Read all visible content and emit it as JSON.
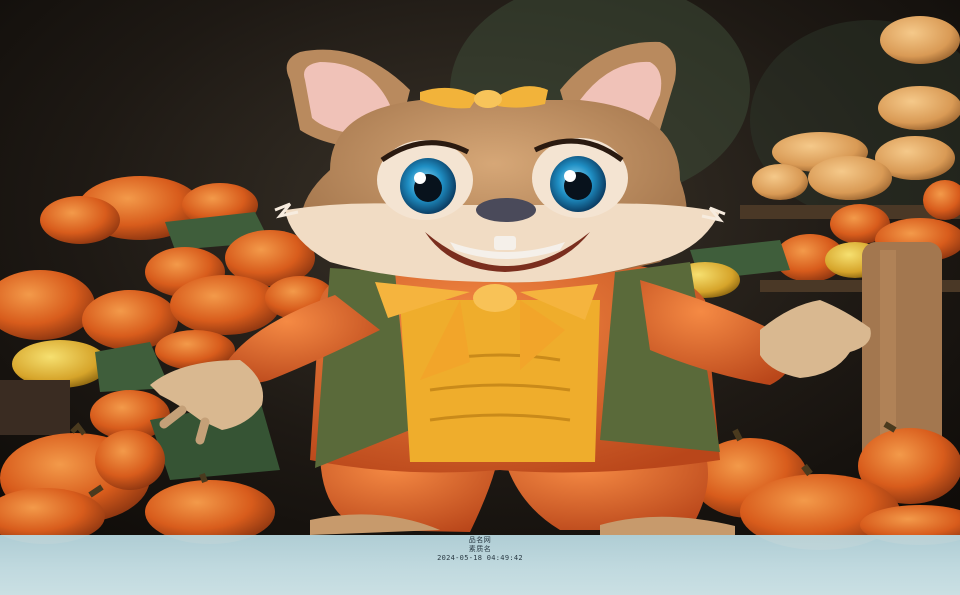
{
  "image": {
    "description_icon": "cartoon-squirrel-with-pumpkins",
    "colors": {
      "fur": "#b98a5e",
      "fur_light": "#f1dcc4",
      "jacket": "#e2652a",
      "vest": "#5c6b3c",
      "shirt": "#f2b532",
      "bow": "#f3b23f",
      "pumpkin": "#e06a22",
      "band": "#c9e4ea"
    }
  },
  "watermark": {
    "line1": "品名网",
    "line2": "素质名",
    "timestamp": "2024-05-18 04:49:42"
  }
}
